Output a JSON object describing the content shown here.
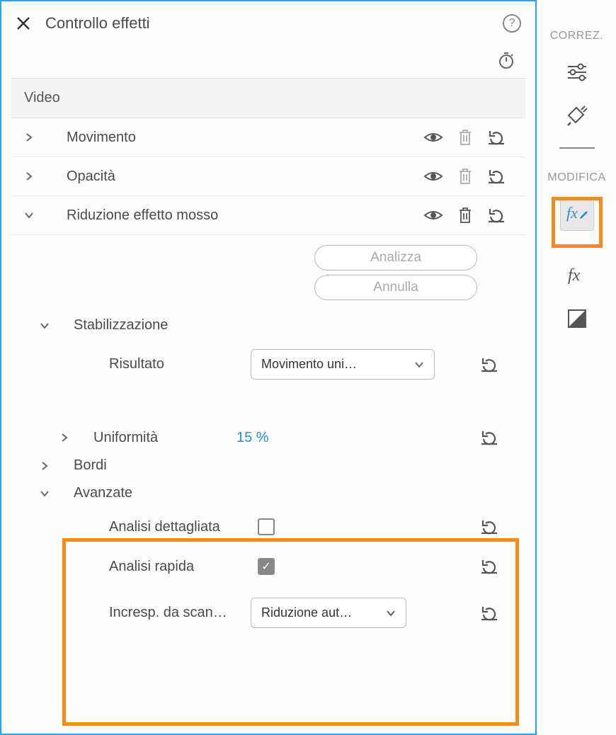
{
  "header": {
    "title": "Controllo effetti"
  },
  "section": {
    "video": "Video"
  },
  "effects": {
    "motion": "Movimento",
    "opacity": "Opacità",
    "shake": "Riduzione effetto mosso"
  },
  "buttons": {
    "analyze": "Analizza",
    "cancel": "Annulla"
  },
  "stabilization": {
    "title": "Stabilizzazione",
    "result_label": "Risultato",
    "result_value": "Movimento uni…",
    "uniformity_label": "Uniformità",
    "uniformity_value": "15 %",
    "borders": "Bordi",
    "advanced": "Avanzate"
  },
  "advanced": {
    "detailed": "Analisi dettagliata",
    "fast": "Analisi rapida",
    "ripple_label": "Incresp. da scan…",
    "ripple_value": "Riduzione aut…"
  },
  "sidebar": {
    "correz": "CORREZ.",
    "modifica": "MODIFICA"
  }
}
